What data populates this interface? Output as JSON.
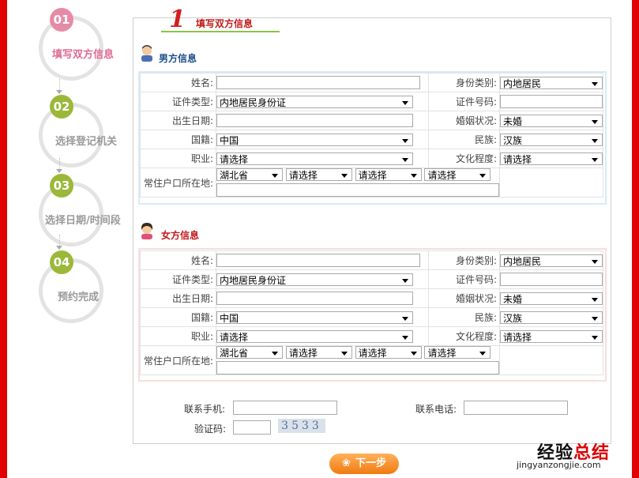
{
  "steps": [
    {
      "num": "01",
      "label": "填写双方信息"
    },
    {
      "num": "02",
      "label": "选择登记机关"
    },
    {
      "num": "03",
      "label": "选择日期/时间段"
    },
    {
      "num": "04",
      "label": "预约完成"
    }
  ],
  "tab": {
    "num": "1",
    "title": "填写双方信息"
  },
  "male": {
    "title": "男方信息",
    "name_label": "姓名:",
    "idtype_label": "证件类型:",
    "idtype_value": "内地居民身份证",
    "birth_label": "出生日期:",
    "nation_label": "国籍:",
    "nation_value": "中国",
    "job_label": "职业:",
    "job_value": "请选择",
    "hukou_label": "常住户口所在地:",
    "province": "湖北省",
    "city": "请选择",
    "district": "请选择",
    "street": "请选择",
    "identity_label": "身份类别:",
    "identity_value": "内地居民",
    "idno_label": "证件号码:",
    "marital_label": "婚姻状况:",
    "marital_value": "未婚",
    "ethnic_label": "民族:",
    "ethnic_value": "汉族",
    "edu_label": "文化程度:",
    "edu_value": "请选择"
  },
  "female": {
    "title": "女方信息",
    "name_label": "姓名:",
    "idtype_label": "证件类型:",
    "idtype_value": "内地居民身份证",
    "birth_label": "出生日期:",
    "nation_label": "国籍:",
    "nation_value": "中国",
    "job_label": "职业:",
    "job_value": "请选择",
    "hukou_label": "常住户口所在地:",
    "province": "湖北省",
    "city": "请选择",
    "district": "请选择",
    "street": "请选择",
    "identity_label": "身份类别:",
    "identity_value": "内地居民",
    "idno_label": "证件号码:",
    "marital_label": "婚姻状况:",
    "marital_value": "未婚",
    "ethnic_label": "民族:",
    "ethnic_value": "汉族",
    "edu_label": "文化程度:",
    "edu_value": "请选择"
  },
  "contact": {
    "mobile_label": "联系手机:",
    "phone_label": "联系电话:",
    "captcha_label": "验证码:",
    "captcha_text": "3533"
  },
  "next_label": "下一步",
  "watermark": {
    "prefix": "经验",
    "highlight": "总结",
    "url": "jingyanzongjie.com"
  }
}
